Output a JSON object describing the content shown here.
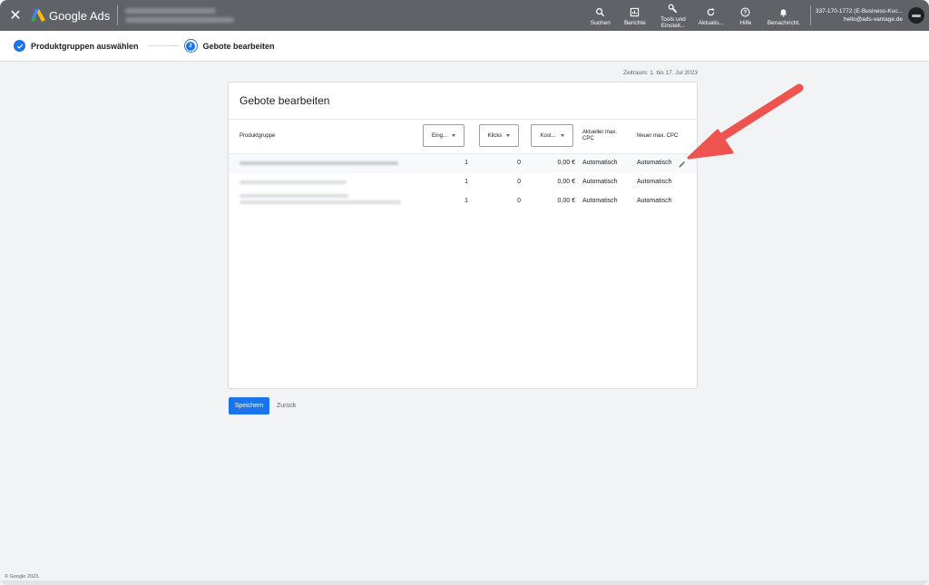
{
  "colors": {
    "topbar": "#5f6368",
    "accent": "#1a73e8",
    "annotation_arrow": "#ef5350"
  },
  "topbar": {
    "logo_text": "Google Ads",
    "tools": [
      {
        "icon": "search-icon",
        "label": "Suchen"
      },
      {
        "icon": "reports-icon",
        "label": "Berichte"
      },
      {
        "icon": "wrench-icon",
        "label": "Tools und Einstell..."
      },
      {
        "icon": "refresh-icon",
        "label": "Aktualis..."
      },
      {
        "icon": "help-icon",
        "label": "Hilfe"
      },
      {
        "icon": "bell-icon",
        "label": "Benachricht."
      }
    ],
    "account_id": "337-170-1772 (E-Business-Kuc...",
    "account_email": "hello@ads-vantage.de"
  },
  "steps": [
    {
      "label": "Produktgruppen auswählen",
      "state": "done"
    },
    {
      "label": "Gebote bearbeiten",
      "number": "2",
      "state": "current"
    }
  ],
  "date_range": "Zeitraum: 1. bis 17. Jul 2023",
  "card": {
    "title": "Gebote bearbeiten",
    "columns": {
      "product_group": "Produktgruppe",
      "impressions": "Eing...",
      "clicks": "Klicks",
      "cost": "Kost...",
      "current_cpc": "Aktueller max. CPC",
      "new_cpc": "Neuer max. CPC"
    },
    "rows": [
      {
        "impressions": "1",
        "clicks": "0",
        "cost": "0,00 €",
        "current_cpc": "Automatisch",
        "new_cpc": "Automatisch"
      },
      {
        "impressions": "1",
        "clicks": "0",
        "cost": "0,00 €",
        "current_cpc": "Automatisch",
        "new_cpc": "Automatisch"
      },
      {
        "impressions": "1",
        "clicks": "0",
        "cost": "0,00 €",
        "current_cpc": "Automatisch",
        "new_cpc": "Automatisch"
      }
    ]
  },
  "actions": {
    "save": "Speichern",
    "back": "Zurück"
  },
  "footer": "© Google 2023."
}
